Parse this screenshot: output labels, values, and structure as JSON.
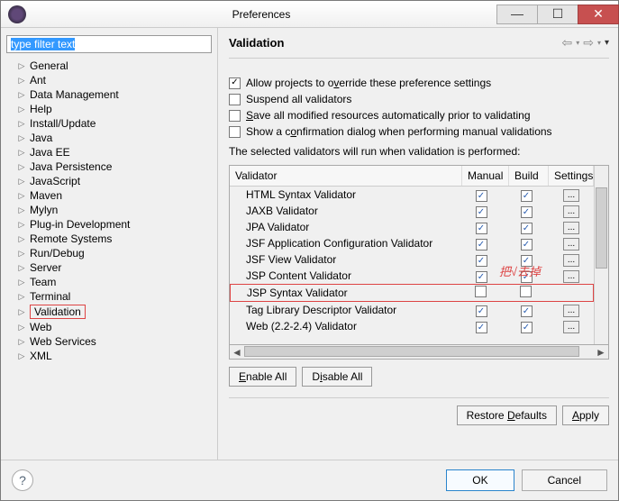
{
  "window": {
    "title": "Preferences"
  },
  "filter": {
    "text": "type filter text"
  },
  "tree": {
    "items": [
      "General",
      "Ant",
      "Data Management",
      "Help",
      "Install/Update",
      "Java",
      "Java EE",
      "Java Persistence",
      "JavaScript",
      "Maven",
      "Mylyn",
      "Plug-in Development",
      "Remote Systems",
      "Run/Debug",
      "Server",
      "Team",
      "Terminal",
      "Validation",
      "Web",
      "Web Services",
      "XML"
    ],
    "selected": "Validation"
  },
  "page": {
    "title": "Validation",
    "checks": {
      "allow_override": "Allow projects to override these preference settings",
      "allow_override_checked": true,
      "suspend": "Suspend all validators",
      "suspend_checked": false,
      "save": "Save all modified resources automatically prior to validating",
      "save_checked": false,
      "confirm": "Show a confirmation dialog when performing manual validations",
      "confirm_checked": false
    },
    "info": "The selected validators will run when validation is performed:",
    "columns": {
      "name": "Validator",
      "manual": "Manual",
      "build": "Build",
      "settings": "Settings"
    },
    "rows": [
      {
        "name": "HTML Syntax Validator",
        "manual": true,
        "build": true,
        "settings": true
      },
      {
        "name": "JAXB Validator",
        "manual": true,
        "build": true,
        "settings": true
      },
      {
        "name": "JPA Validator",
        "manual": true,
        "build": true,
        "settings": true
      },
      {
        "name": "JSF Application Configuration Validator",
        "manual": true,
        "build": true,
        "settings": true
      },
      {
        "name": "JSF View Validator",
        "manual": true,
        "build": true,
        "settings": true
      },
      {
        "name": "JSP Content Validator",
        "manual": true,
        "build": true,
        "settings": true
      },
      {
        "name": "JSP Syntax Validator",
        "manual": false,
        "build": false,
        "settings": false,
        "highlight": true
      },
      {
        "name": "Tag Library Descriptor Validator",
        "manual": true,
        "build": true,
        "settings": true
      },
      {
        "name": "Web (2.2-2.4) Validator",
        "manual": true,
        "build": true,
        "settings": true
      }
    ],
    "enable_all": "Enable All",
    "disable_all": "Disable All",
    "restore": "Restore Defaults",
    "apply": "Apply"
  },
  "footer": {
    "ok": "OK",
    "cancel": "Cancel"
  },
  "annotation": "把√去掉"
}
